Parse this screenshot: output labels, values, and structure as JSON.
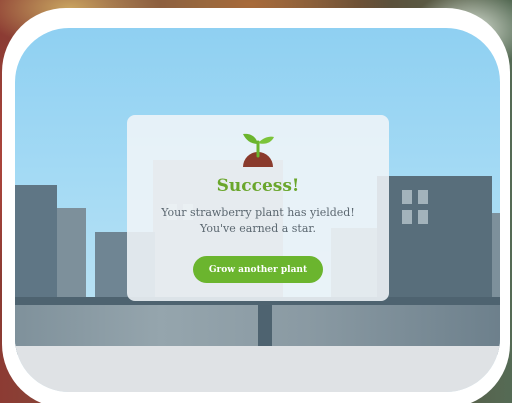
{
  "dialog": {
    "icon": "sprout-icon",
    "title": "Success!",
    "message_line1": "Your strawberry plant has yielded!",
    "message_line2": "You've earned a star.",
    "button_label": "Grow another plant"
  },
  "colors": {
    "accent": "#6bb52e",
    "title": "#6aa62c",
    "sky": "#8fd0f2"
  }
}
